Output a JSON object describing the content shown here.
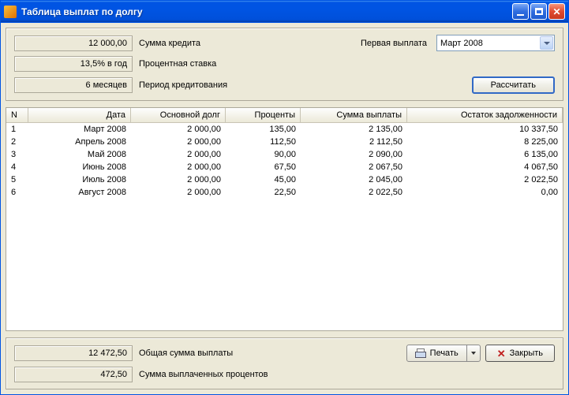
{
  "window": {
    "title": "Таблица выплат по долгу"
  },
  "inputs": {
    "credit_sum": "12 000,00",
    "credit_sum_label": "Сумма кредита",
    "rate": "13,5% в год",
    "rate_label": "Процентная ставка",
    "period": "6 месяцев",
    "period_label": "Период кредитования",
    "first_payment_label": "Первая выплата",
    "first_payment_value": "Март 2008",
    "calc_button": "Рассчитать"
  },
  "table": {
    "headers": {
      "n": "N",
      "date": "Дата",
      "principal": "Основной долг",
      "interest": "Проценты",
      "payment": "Сумма выплаты",
      "balance": "Остаток задолженности"
    },
    "rows": [
      {
        "n": "1",
        "date": "Март 2008",
        "principal": "2 000,00",
        "interest": "135,00",
        "payment": "2 135,00",
        "balance": "10 337,50"
      },
      {
        "n": "2",
        "date": "Апрель 2008",
        "principal": "2 000,00",
        "interest": "112,50",
        "payment": "2 112,50",
        "balance": "8 225,00"
      },
      {
        "n": "3",
        "date": "Май 2008",
        "principal": "2 000,00",
        "interest": "90,00",
        "payment": "2 090,00",
        "balance": "6 135,00"
      },
      {
        "n": "4",
        "date": "Июнь 2008",
        "principal": "2 000,00",
        "interest": "67,50",
        "payment": "2 067,50",
        "balance": "4 067,50"
      },
      {
        "n": "5",
        "date": "Июль 2008",
        "principal": "2 000,00",
        "interest": "45,00",
        "payment": "2 045,00",
        "balance": "2 022,50"
      },
      {
        "n": "6",
        "date": "Август 2008",
        "principal": "2 000,00",
        "interest": "22,50",
        "payment": "2 022,50",
        "balance": "0,00"
      }
    ]
  },
  "summary": {
    "total_payment": "12 472,50",
    "total_payment_label": "Общая сумма выплаты",
    "total_interest": "472,50",
    "total_interest_label": "Сумма выплаченных процентов"
  },
  "actions": {
    "print": "Печать",
    "close": "Закрыть"
  }
}
